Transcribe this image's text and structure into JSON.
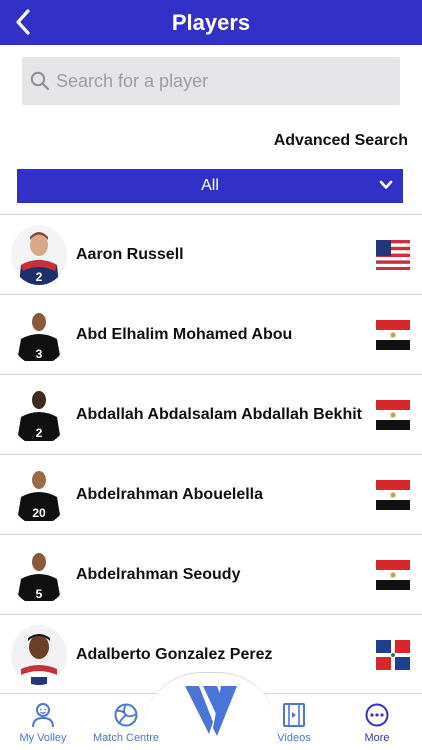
{
  "header": {
    "title": "Players"
  },
  "search": {
    "placeholder": "Search for a player"
  },
  "advanced_search_label": "Advanced Search",
  "filter": {
    "selected": "All"
  },
  "players": [
    {
      "name": "Aaron Russell",
      "jersey": "2",
      "flag": "usa-flag",
      "kit": "usa"
    },
    {
      "name": "Abd Elhalim Mohamed Abou",
      "jersey": "3",
      "flag": "egypt-flag",
      "kit": "egypt"
    },
    {
      "name": "Abdallah Abdalsalam Abdallah Bekhit",
      "jersey": "2",
      "flag": "egypt-flag",
      "kit": "egypt"
    },
    {
      "name": "Abdelrahman Abouelella",
      "jersey": "20",
      "flag": "egypt-flag",
      "kit": "egypt"
    },
    {
      "name": "Abdelrahman Seoudy",
      "jersey": "5",
      "flag": "egypt-flag",
      "kit": "egypt"
    },
    {
      "name": "Adalberto Gonzalez Perez",
      "jersey": "",
      "flag": "dominican-republic-flag",
      "kit": "dominican"
    }
  ],
  "tabbar": {
    "my_volley": "My Volley",
    "match_centre": "Match Centre",
    "videos": "Videos",
    "more": "More"
  },
  "colors": {
    "brand": "#3131c8",
    "tab_icon": "#4a74d6",
    "search_bg": "#e5e5e8"
  }
}
